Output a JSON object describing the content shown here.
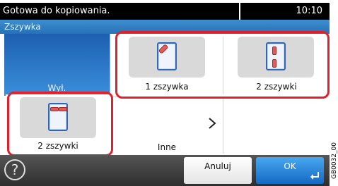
{
  "status": {
    "message": "Gotowa do kopiowania.",
    "time": "10:10"
  },
  "screen_title": "Zszywka",
  "options": {
    "off_label": "Wył.",
    "one_staple_label": "1 zszywka",
    "two_staples_left_label": "2 zszywki",
    "two_staples_top_label": "2 zszywki",
    "more_label": "Inne"
  },
  "footer": {
    "help_glyph": "?",
    "cancel_label": "Anuluj",
    "ok_label": "OK"
  },
  "side_code": "GB0032_00",
  "colors": {
    "highlight": "#e0202a",
    "accent_blue": "#2771b6",
    "staple": "#e05a5a"
  }
}
